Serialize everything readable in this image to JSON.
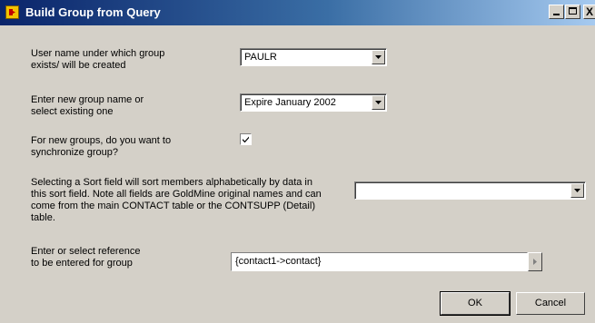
{
  "window": {
    "title": "Build Group from Query",
    "controls": {
      "minimize": "_",
      "maximize": "□",
      "close": "X"
    }
  },
  "fields": {
    "user": {
      "label_line1": "User name under which group",
      "label_line2": "exists/ will be created",
      "value": "PAULR"
    },
    "group": {
      "label_line1": "Enter new group name or",
      "label_line2": "select existing one",
      "value": "Expire January 2002"
    },
    "sync": {
      "label_line1": "For new groups, do you want to",
      "label_line2": "synchronize group?",
      "checked": true
    },
    "sort": {
      "label_line1": "Selecting a Sort field will sort members alphabetically by data in",
      "label_line2": "this sort field. Note all fields are GoldMine original names and can",
      "label_line3": "come from the main CONTACT table or the CONTSUPP (Detail)",
      "label_line4": "table.",
      "value": ""
    },
    "reference": {
      "label_line1": "Enter or select reference",
      "label_line2": "to be entered for group",
      "value": "{contact1->contact}"
    }
  },
  "buttons": {
    "ok": "OK",
    "cancel": "Cancel"
  },
  "icons": {
    "app": "goldmine-app-icon",
    "dropdown": "chevron-down-icon",
    "side": "chevron-right-icon",
    "check": "check-icon"
  }
}
